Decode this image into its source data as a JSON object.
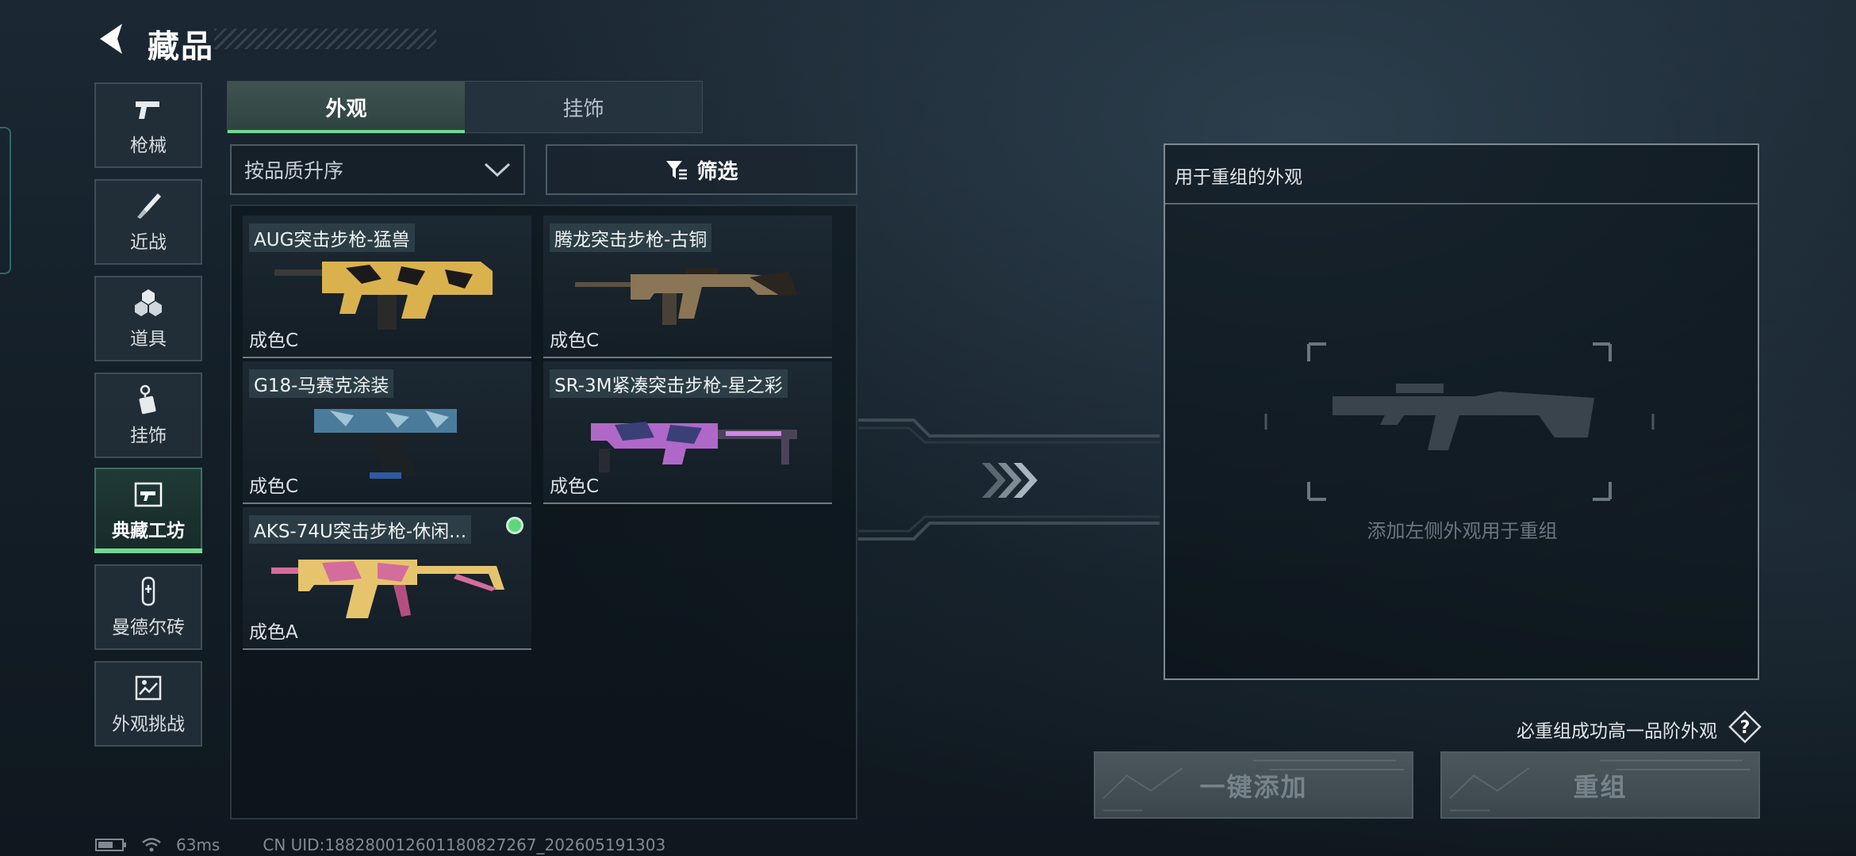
{
  "header": {
    "title": "藏品"
  },
  "sidebar": {
    "items": [
      {
        "label": "枪械",
        "icon": "pistol-icon",
        "active": false
      },
      {
        "label": "近战",
        "icon": "knife-icon",
        "active": false
      },
      {
        "label": "道具",
        "icon": "cubes-icon",
        "active": false
      },
      {
        "label": "挂饰",
        "icon": "keychain-icon",
        "active": false
      },
      {
        "label": "典藏工坊",
        "icon": "frame-gun-icon",
        "active": true
      },
      {
        "label": "曼德尔砖",
        "icon": "brick-icon",
        "active": false
      },
      {
        "label": "外观挑战",
        "icon": "challenge-icon",
        "active": false
      }
    ]
  },
  "tabs": [
    {
      "label": "外观",
      "active": true
    },
    {
      "label": "挂饰",
      "active": false
    }
  ],
  "sort": {
    "label": "按品质升序"
  },
  "filter": {
    "label": "筛选"
  },
  "items": [
    {
      "name": "AUG突击步枪-猛兽",
      "grade": "成色C",
      "selected": false,
      "colors": [
        "#d9b24e",
        "#1a1a1a"
      ]
    },
    {
      "name": "腾龙突击步枪-古铜",
      "grade": "成色C",
      "selected": false,
      "colors": [
        "#8a7656",
        "#2b2520"
      ]
    },
    {
      "name": "G18-马赛克涂装",
      "grade": "成色C",
      "selected": false,
      "colors": [
        "#4a7b9b",
        "#1c2126"
      ]
    },
    {
      "name": "SR-3M紧凑突击步枪-星之彩",
      "grade": "成色C",
      "selected": false,
      "colors": [
        "#b068c8",
        "#3a3f78"
      ]
    },
    {
      "name": "AKS-74U突击步枪-休闲...",
      "grade": "成色A",
      "selected": true,
      "colors": [
        "#e6c46e",
        "#d46c9c"
      ]
    }
  ],
  "recombine": {
    "title": "用于重组的外观",
    "placeholder": "添加左侧外观用于重组"
  },
  "hint": "必重组成功高一品阶外观",
  "buttons": {
    "add": "一键添加",
    "combine": "重组"
  },
  "status": {
    "ping": "63ms",
    "uid": "CN UID:18828001260118082726​7_202605191303"
  },
  "colors": {
    "accent": "#72d98f",
    "panel_border": "#7e8b95",
    "background": "#141f28"
  }
}
